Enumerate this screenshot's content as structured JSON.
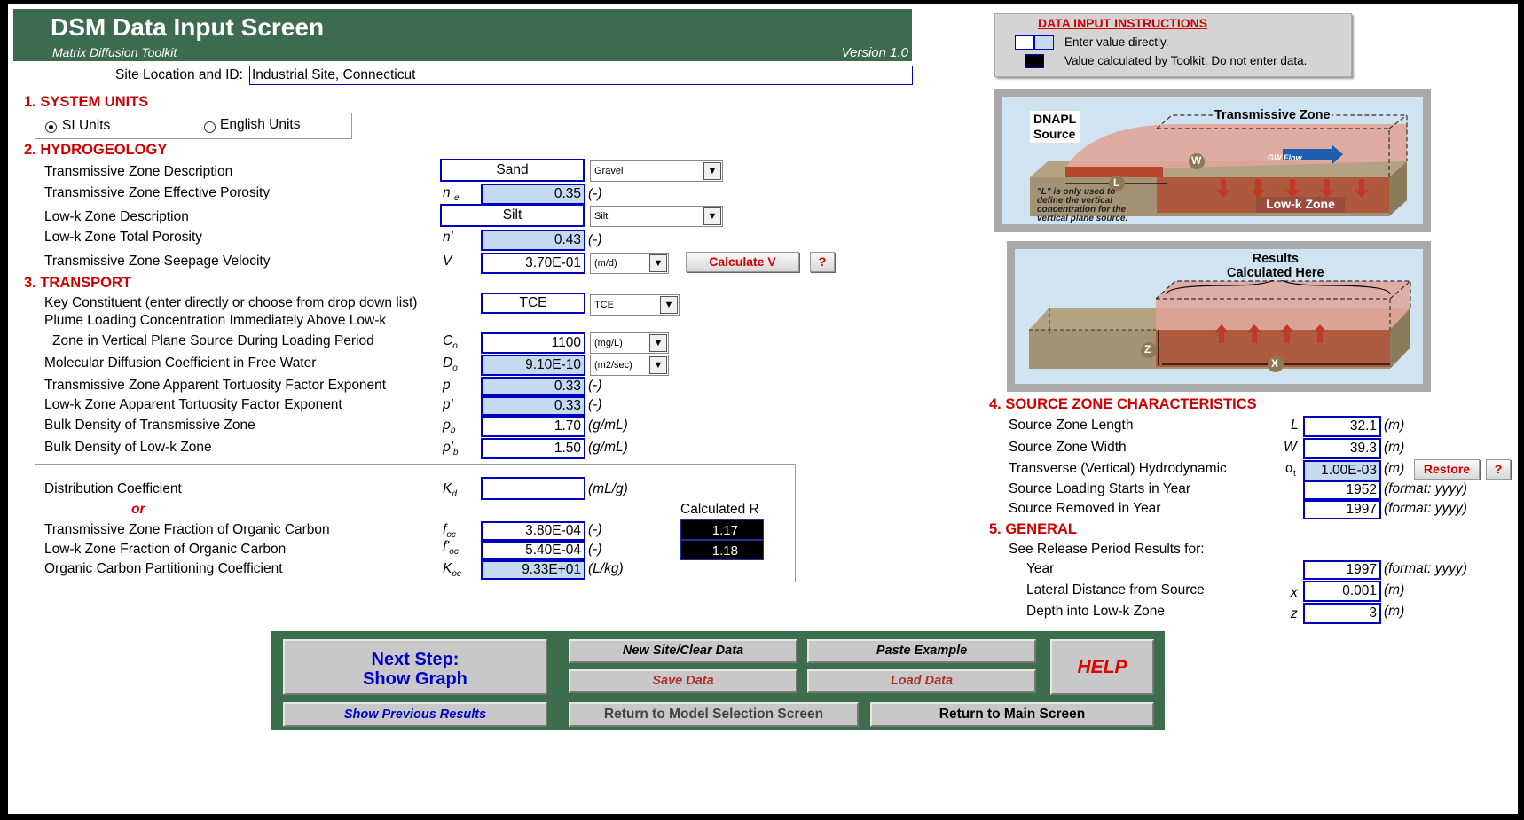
{
  "header": {
    "title": "DSM Data Input Screen",
    "subtitle": "Matrix Diffusion Toolkit",
    "version": "Version 1.0"
  },
  "site": {
    "label": "Site Location and ID:",
    "value": "Industrial Site, Connecticut"
  },
  "instructions": {
    "title": "DATA  INPUT  INSTRUCTIONS",
    "enter_text": "Enter value directly.",
    "calc_text": "Value calculated by Toolkit. Do not enter data."
  },
  "sections": {
    "s1": "1.  SYSTEM UNITS",
    "s2": "2.  HYDROGEOLOGY",
    "s3": "3.  TRANSPORT",
    "s4": "4.  SOURCE ZONE CHARACTERISTICS",
    "s5": "5.  GENERAL"
  },
  "units": {
    "si": "SI Units",
    "english": "English Units",
    "selected": "si"
  },
  "hydro": {
    "tz_desc": {
      "label": "Transmissive Zone Description",
      "value": "Sand",
      "dropdown": "Gravel"
    },
    "tz_por": {
      "label": "Transmissive Zone Effective Porosity",
      "symbol": "n",
      "sub": "e",
      "value": "0.35",
      "unit": "(-)"
    },
    "lk_desc": {
      "label": "Low-k Zone Description",
      "value": "Silt",
      "dropdown": "Silt"
    },
    "lk_por": {
      "label": "Low-k Zone Total Porosity",
      "symbol": "n'",
      "value": "0.43",
      "unit": "(-)"
    },
    "vel": {
      "label": "Transmissive Zone Seepage Velocity",
      "symbol": "V",
      "value": "3.70E-01",
      "dropdown": "(m/d)",
      "button": "Calculate V",
      "help": "?"
    }
  },
  "transport": {
    "key": {
      "label": "Key Constituent (enter directly or choose from drop down list)",
      "value": "TCE",
      "dropdown": "TCE"
    },
    "conc_line1": "Plume Loading Concentration Immediately Above Low-k",
    "conc": {
      "label": "Zone in Vertical Plane Source During Loading Period",
      "symbol": "C",
      "sub": "o",
      "value": "1100",
      "dropdown": "(mg/L)"
    },
    "diff": {
      "label": "Molecular Diffusion Coefficient in Free Water",
      "symbol": "D",
      "sub": "o",
      "value": "9.10E-10",
      "dropdown": "(m2/sec)"
    },
    "tort_tz": {
      "label": "Transmissive Zone Apparent Tortuosity Factor Exponent",
      "symbol": "p",
      "value": "0.33",
      "unit": "(-)"
    },
    "tort_lk": {
      "label": "Low-k Zone Apparent Tortuosity Factor Exponent",
      "symbol": "p'",
      "value": "0.33",
      "unit": "(-)"
    },
    "bd_tz": {
      "label": "Bulk Density of Transmissive Zone",
      "symbol": "ρ",
      "sub": "b",
      "value": "1.70",
      "unit": "(g/mL)"
    },
    "bd_lk": {
      "label": "Bulk Density of Low-k Zone",
      "symbol": "ρ'",
      "sub": "b",
      "value": "1.50",
      "unit": "(g/mL)"
    },
    "kd": {
      "label": "Distribution Coefficient",
      "symbol": "K",
      "sub": "d",
      "value": "",
      "unit": "(mL/g)"
    },
    "or": "or",
    "calc_r_label": "Calculated R",
    "foc_tz": {
      "label": "Transmissive Zone Fraction of Organic Carbon",
      "symbol": "f",
      "sub": "oc",
      "value": "3.80E-04",
      "unit": "(-)",
      "r": "1.17"
    },
    "foc_lk": {
      "label": "Low-k Zone Fraction of Organic Carbon",
      "symbol": "f'",
      "sub": "oc",
      "value": "5.40E-04",
      "unit": "(-)",
      "r": "1.18"
    },
    "koc": {
      "label": "Organic Carbon Partitioning Coefficient",
      "symbol": "K",
      "sub": "oc",
      "value": "9.33E+01",
      "unit": "(L/kg)"
    }
  },
  "source": {
    "length": {
      "label": "Source Zone Length",
      "symbol": "L",
      "value": "32.1",
      "unit": "(m)"
    },
    "width": {
      "label": "Source Zone Width",
      "symbol": "W",
      "value": "39.3",
      "unit": "(m)"
    },
    "disp": {
      "label": "Transverse (Vertical) Hydrodynamic",
      "symbol": "α",
      "sub": "t",
      "value": "1.00E-03",
      "unit": "(m)",
      "button": "Restore",
      "help": "?"
    },
    "start": {
      "label": "Source Loading Starts in Year",
      "value": "1952",
      "unit": "(format: yyyy)"
    },
    "removed": {
      "label": "Source Removed in Year",
      "value": "1997",
      "unit": "(format: yyyy)"
    }
  },
  "general": {
    "see": "See Release Period Results for:",
    "year": {
      "label": "Year",
      "value": "1997",
      "unit": "(format: yyyy)"
    },
    "lat": {
      "label": "Lateral Distance from Source",
      "symbol": "x",
      "value": "0.001",
      "unit": "(m)"
    },
    "depth": {
      "label": "Depth into Low-k Zone",
      "symbol": "z",
      "value": "3",
      "unit": "(m)"
    }
  },
  "diagram1": {
    "dnapl": "DNAPL",
    "source": "Source",
    "tz": "Transmissive Zone",
    "gw": "GW Flow",
    "L": "L",
    "W": "W",
    "lowk": "Low-k Zone",
    "note1": "\"L\" is only used to",
    "note2": "define the vertical",
    "note3": "concentration for the",
    "note4": "vertical plane source."
  },
  "diagram2": {
    "results1": "Results",
    "results2": "Calculated Here",
    "Z": "Z",
    "X": "X"
  },
  "buttons": {
    "next": "Next Step:",
    "show_graph": "Show Graph",
    "new_site": "New Site/Clear Data",
    "paste": "Paste Example",
    "save": "Save Data",
    "load": "Load Data",
    "help": "HELP",
    "prev": "Show Previous  Results",
    "model_sel": "Return to Model Selection Screen",
    "main": "Return to Main Screen"
  },
  "colors": {
    "header_green": "#3d6b50",
    "panel_green": "#3c6e4d",
    "input_blue": "#c5d9f1",
    "section_red": "#d00000",
    "input_border": "#0000c0"
  }
}
